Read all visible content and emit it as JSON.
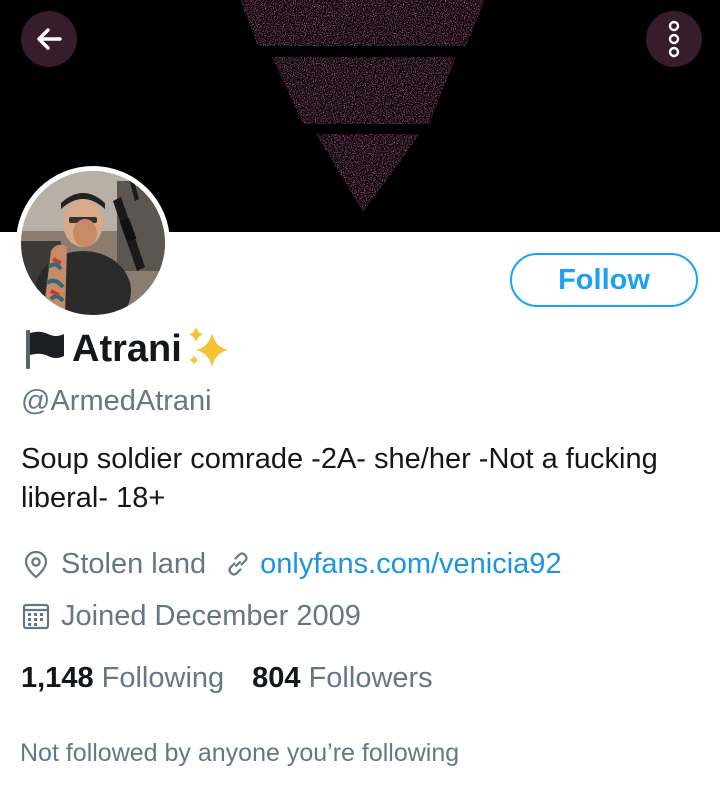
{
  "header": {
    "back_icon": "arrow-left-icon",
    "more_icon": "more-vertical-icon",
    "banner_colors": {
      "background": "#000000",
      "triangle": "#e07ab0"
    }
  },
  "profile": {
    "display_name": "Atrani",
    "flag_emoji": "black-flag-icon",
    "sparkle_emoji": "sparkles-icon",
    "handle": "@ArmedAtrani",
    "bio": "Soup soldier comrade -2A- she/her -Not a fucking liberal- 18+",
    "location": "Stolen land",
    "website": "onlyfans.com/venicia92",
    "joined": "Joined December 2009"
  },
  "actions": {
    "follow_label": "Follow"
  },
  "stats": {
    "following_count": "1,148",
    "following_label": "Following",
    "followers_count": "804",
    "followers_label": "Followers"
  },
  "footer": {
    "not_followed_text": "Not followed by anyone you’re following"
  },
  "colors": {
    "accent": "#1da1f2",
    "link": "#1b95e0",
    "secondary_text": "#657786",
    "primary_text": "#14171a"
  }
}
